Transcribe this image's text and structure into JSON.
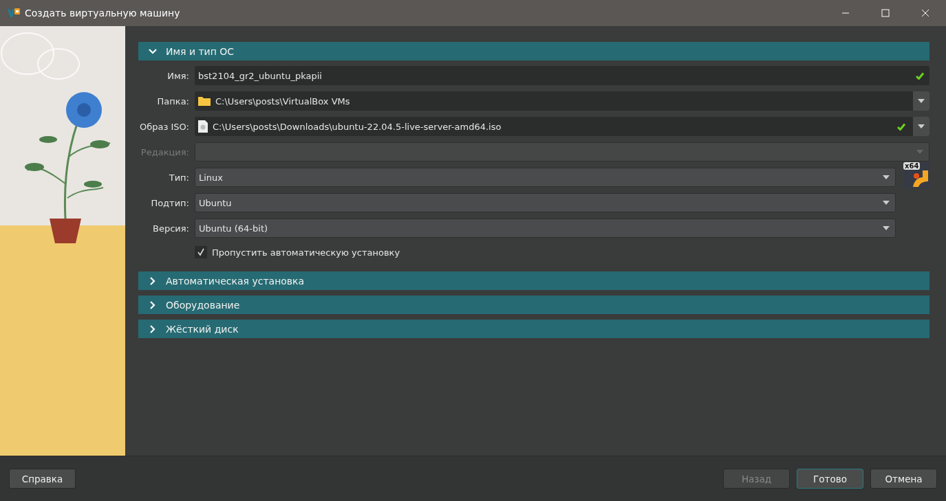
{
  "window": {
    "title": "Создать виртуальную машину"
  },
  "sections": [
    {
      "title": "Имя и тип ОС",
      "expanded": true
    },
    {
      "title": "Автоматическая установка",
      "expanded": false
    },
    {
      "title": "Оборудование",
      "expanded": false
    },
    {
      "title": "Жёсткий диск",
      "expanded": false
    }
  ],
  "fields": [
    {
      "label": "Имя:",
      "kind": "input",
      "value": "bst2104_gr2_ubuntu_pkapii",
      "valid": true,
      "disabled": false
    },
    {
      "label": "Папка:",
      "kind": "folder",
      "value": "C:\\Users\\posts\\VirtualBox VMs",
      "valid": false,
      "disabled": false
    },
    {
      "label": "Образ ISO:",
      "kind": "iso",
      "value": "C:\\Users\\posts\\Downloads\\ubuntu-22.04.5-live-server-amd64.iso",
      "valid": true,
      "disabled": false
    },
    {
      "label": "Редакция:",
      "kind": "combo",
      "disabled": true
    },
    {
      "label": "Тип:",
      "kind": "combo",
      "value": "Linux",
      "disabled": false,
      "os_badge": "x64"
    },
    {
      "label": "Подтип:",
      "kind": "combo",
      "value": "Ubuntu",
      "disabled": false
    },
    {
      "label": "Версия:",
      "kind": "combo",
      "value": "Ubuntu (64-bit)",
      "disabled": false
    }
  ],
  "skip_unattended": {
    "label": "Пропустить автоматическую установку",
    "checked": true
  },
  "buttons": [
    {
      "label": "Справка",
      "disabled": false,
      "default": false
    },
    {
      "label": "Назад",
      "disabled": true,
      "default": false
    },
    {
      "label": "Готово",
      "disabled": false,
      "default": true
    },
    {
      "label": "Отмена",
      "disabled": false,
      "default": false
    }
  ]
}
